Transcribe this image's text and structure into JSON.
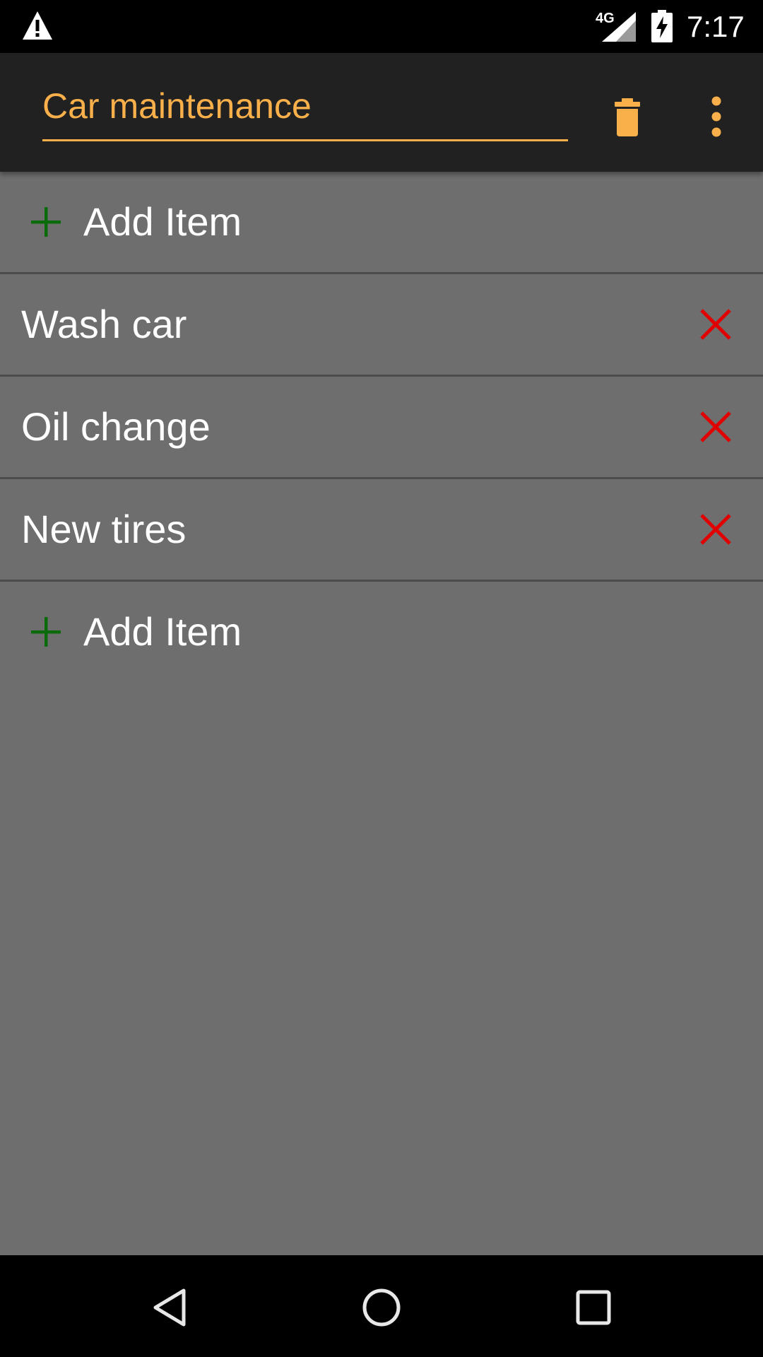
{
  "status_bar": {
    "network": "4G",
    "time": "7:17",
    "icons": [
      "warning-icon",
      "signal-icon",
      "battery-charging-icon"
    ]
  },
  "toolbar": {
    "list_title": "Car maintenance",
    "icons": [
      "trash-icon",
      "more-vert-icon"
    ],
    "accent_color": "#f9b04a"
  },
  "list": {
    "add_top_label": "Add Item",
    "items": [
      {
        "label": "Wash car"
      },
      {
        "label": "Oil change"
      },
      {
        "label": "New tires"
      }
    ],
    "add_bottom_label": "Add Item",
    "plus_color": "#0b6b0b",
    "delete_color": "#e00000"
  },
  "nav_bar": {
    "icons": [
      "back-icon",
      "home-icon",
      "recents-icon"
    ]
  }
}
